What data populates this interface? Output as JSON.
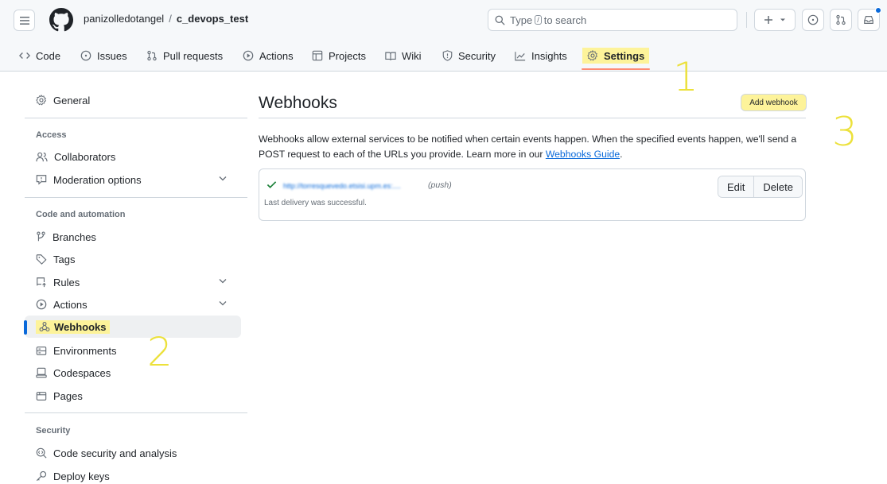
{
  "header": {
    "owner": "panizolledotangel",
    "separator": "/",
    "repo": "c_devops_test",
    "search": {
      "prefix": "Type",
      "key": "/",
      "suffix": "to search"
    }
  },
  "tabs": [
    {
      "label": "Code",
      "icon": "code-icon"
    },
    {
      "label": "Issues",
      "icon": "issue-opened-icon"
    },
    {
      "label": "Pull requests",
      "icon": "git-pull-request-icon"
    },
    {
      "label": "Actions",
      "icon": "play-icon"
    },
    {
      "label": "Projects",
      "icon": "table-icon"
    },
    {
      "label": "Wiki",
      "icon": "book-icon"
    },
    {
      "label": "Security",
      "icon": "shield-icon"
    },
    {
      "label": "Insights",
      "icon": "graph-icon"
    },
    {
      "label": "Settings",
      "icon": "gear-icon",
      "selected": true
    }
  ],
  "sidebar": {
    "general": "General",
    "access_heading": "Access",
    "collaborators": "Collaborators",
    "moderation": "Moderation options",
    "code_heading": "Code and automation",
    "branches": "Branches",
    "tags": "Tags",
    "rules": "Rules",
    "actions": "Actions",
    "webhooks": "Webhooks",
    "environments": "Environments",
    "codespaces": "Codespaces",
    "pages": "Pages",
    "security_heading": "Security",
    "code_security": "Code security and analysis",
    "deploy_keys": "Deploy keys"
  },
  "main": {
    "title": "Webhooks",
    "add_button": "Add webhook",
    "intro_text": "Webhooks allow external services to be notified when certain events happen. When the specified events happen, we'll send a POST request to each of the URLs you provide. Learn more in our",
    "guide_link": "Webhooks Guide",
    "intro_end": ".",
    "hook": {
      "url": "http://torresquevedo.etsisi.upm.es:....",
      "events": "(push)",
      "status": "Last delivery was successful.",
      "edit": "Edit",
      "delete": "Delete"
    }
  },
  "annotations": {
    "one": "1",
    "two": "2",
    "three": "3"
  },
  "colors": {
    "highlight": "#fdf39a",
    "annotation": "#ece13b",
    "link": "#0969da",
    "success": "#1a7f37",
    "tab_underline": "#fd8c73"
  }
}
